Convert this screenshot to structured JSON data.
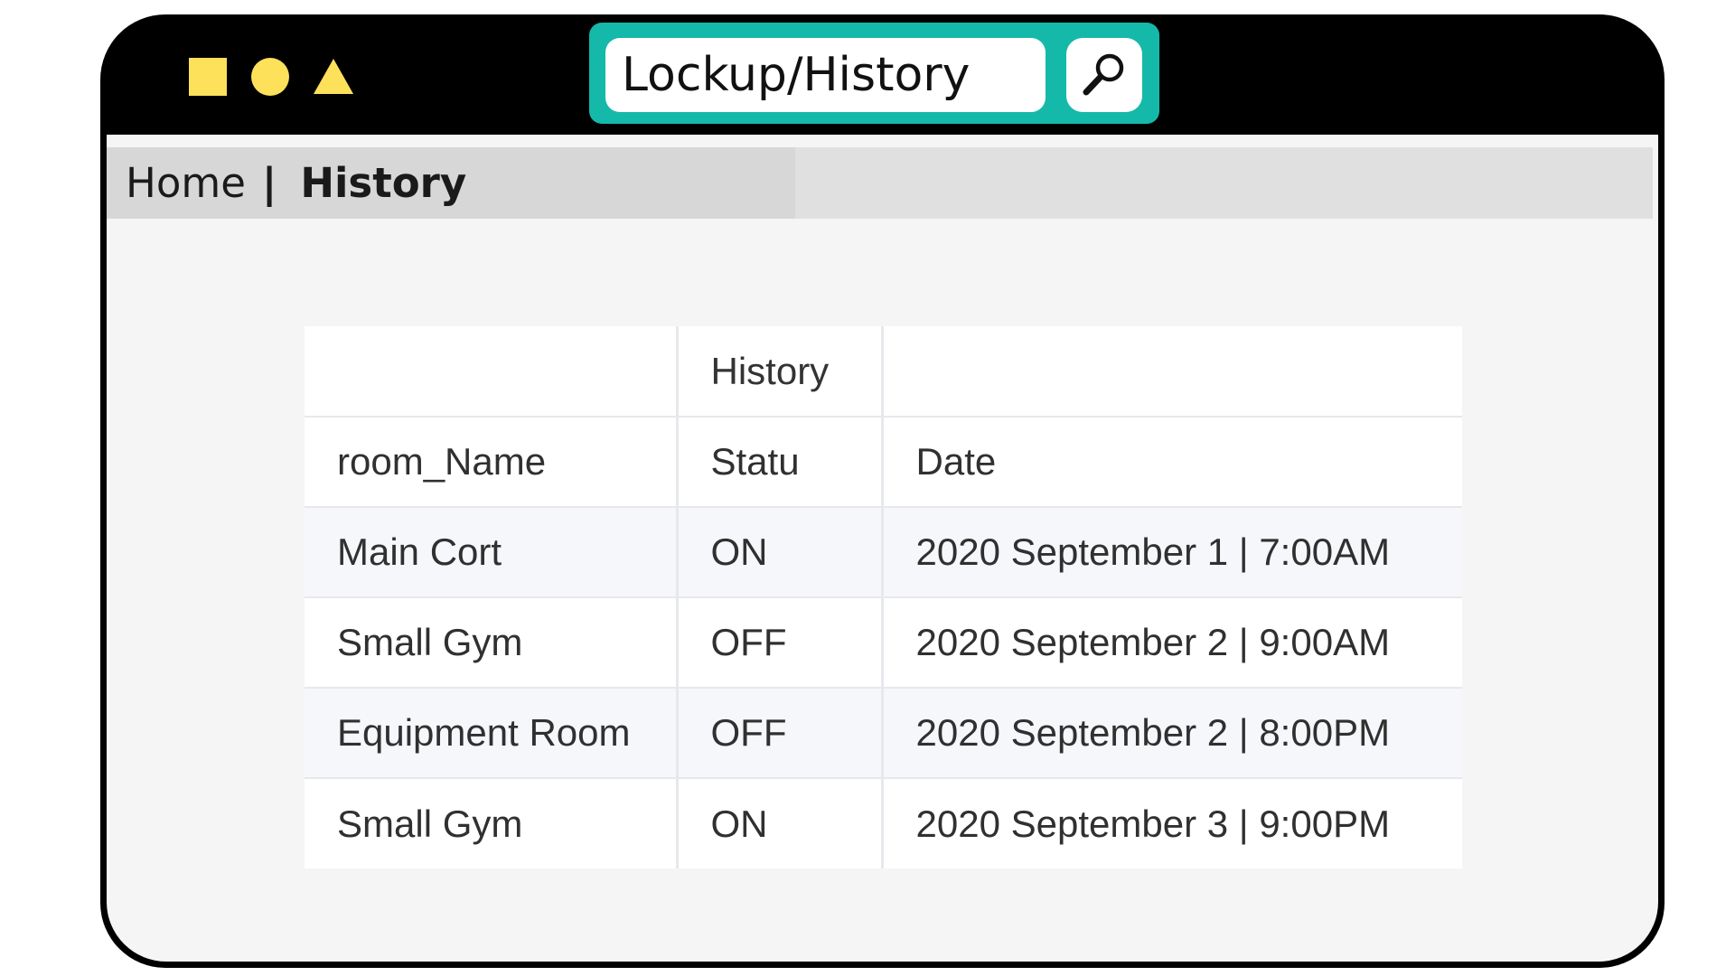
{
  "window": {
    "controls": [
      "square-icon",
      "circle-icon",
      "triangle-icon"
    ],
    "accent_color": "#fde15a"
  },
  "search": {
    "value": "Lockup/History",
    "button_icon": "magnifier-icon",
    "frame_color": "#15b9aa"
  },
  "breadcrumb": {
    "home": "Home",
    "separator": "|",
    "current": "History"
  },
  "table": {
    "caption": "History",
    "headers": [
      "room_Name",
      "Statu",
      "Date"
    ],
    "rows": [
      [
        "Main Cort",
        "ON",
        "2020 September 1 | 7:00AM"
      ],
      [
        "Small Gym",
        "OFF",
        "2020 September 2 | 9:00AM"
      ],
      [
        "Equipment Room",
        "OFF",
        "2020 September 2 | 8:00PM"
      ],
      [
        "Small Gym",
        "ON",
        "2020 September 3 | 9:00PM"
      ]
    ]
  }
}
